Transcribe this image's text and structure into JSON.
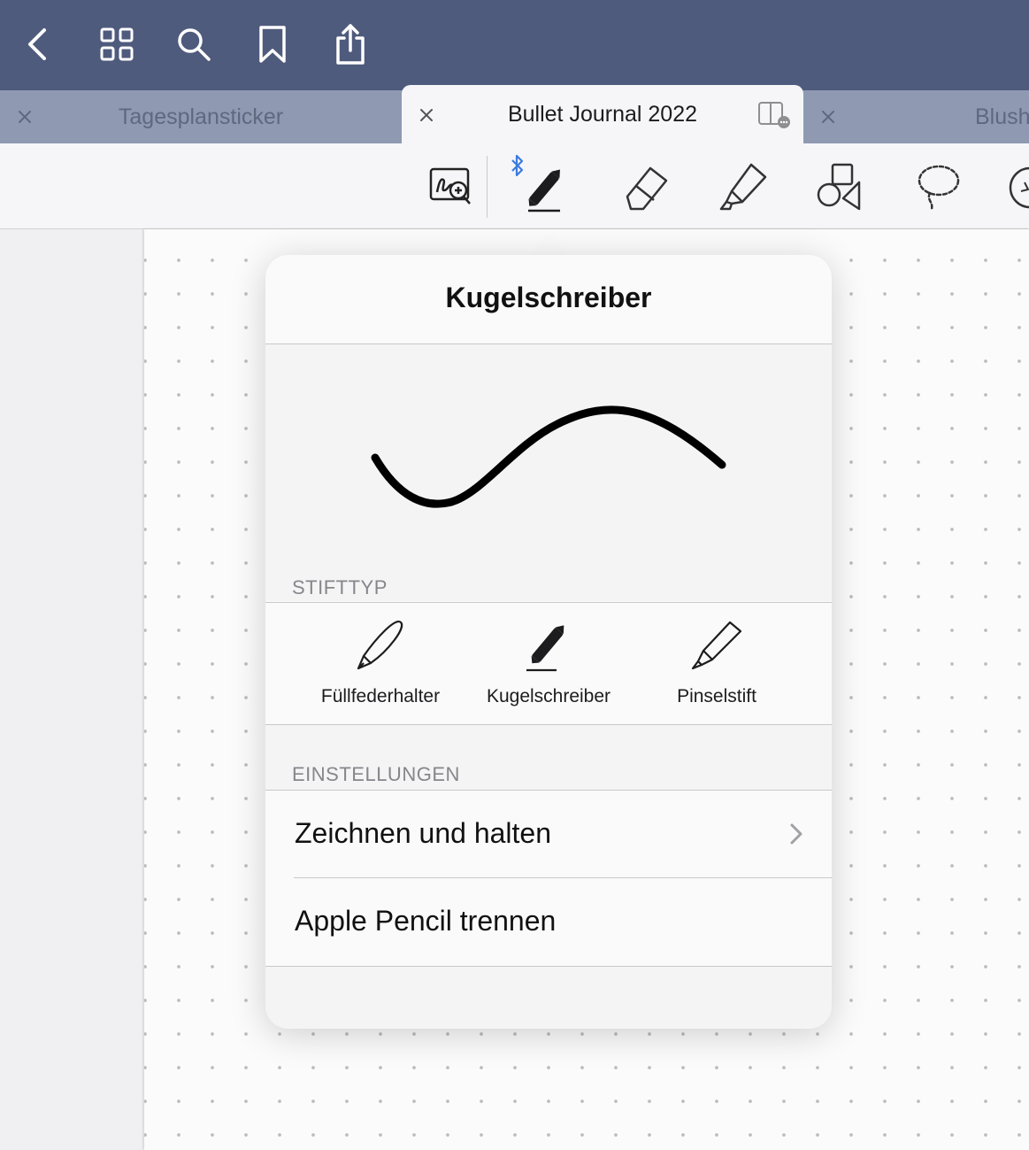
{
  "topbar": {
    "icons": [
      "back-chevron-icon",
      "grid-icon",
      "search-icon",
      "bookmark-icon",
      "share-icon"
    ],
    "background": "#4f5b7d"
  },
  "tabs": [
    {
      "title": "Tagesplansticker",
      "active": false
    },
    {
      "title": "Bullet Journal 2022",
      "active": true
    },
    {
      "title": "Blush",
      "active": false
    }
  ],
  "toolbar": {
    "tools": [
      "zoom-window-icon",
      "ballpoint-pen-icon",
      "eraser-icon",
      "highlighter-icon",
      "shapes-icon",
      "lasso-icon",
      "sticker-icon"
    ],
    "selected": "ballpoint-pen-icon",
    "bluetooth_color": "#3a7be0"
  },
  "popover": {
    "title": "Kugelschreiber",
    "pen_type_section": "STIFTTYP",
    "pen_types": [
      {
        "label": "Füllfederhalter",
        "icon": "fountain-pen-icon"
      },
      {
        "label": "Kugelschreiber",
        "icon": "ballpoint-pen-icon",
        "selected": true
      },
      {
        "label": "Pinselstift",
        "icon": "brush-pen-icon"
      }
    ],
    "settings_section": "EINSTELLUNGEN",
    "settings": [
      {
        "label": "Zeichnen und halten",
        "has_chevron": true
      },
      {
        "label": "Apple Pencil trennen",
        "has_chevron": false
      }
    ]
  }
}
